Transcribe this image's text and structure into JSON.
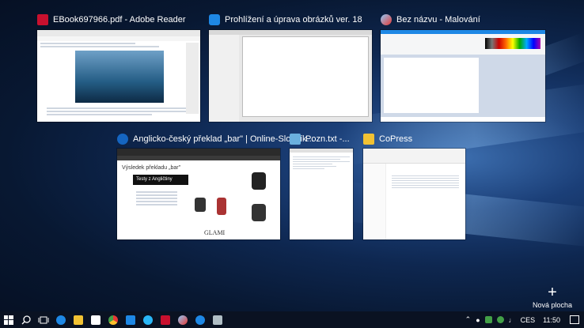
{
  "windows": [
    {
      "id": "adobe",
      "title": "EBook697966.pdf - Adobe Reader",
      "color": "#c8102e"
    },
    {
      "id": "viewer",
      "title": "Prohlížení a úprava obrázků ver. 18",
      "color": "#1e88e5"
    },
    {
      "id": "paint",
      "title": "Bez názvu - Malování",
      "color": "#4aa3df"
    },
    {
      "id": "edge",
      "title": "Anglicko-český překlad „bar\" | Online-Slovník...",
      "color": "#1565c0",
      "page": {
        "heading": "Výsledek překladu „bar\"",
        "ad": "Testy z Angličtiny",
        "brand": "GLAMI"
      }
    },
    {
      "id": "notepad",
      "title": "Pozn.txt -...",
      "color": "#6ab0de"
    },
    {
      "id": "copress",
      "title": "CoPress",
      "color": "#f2c233"
    }
  ],
  "new_desktop": {
    "label": "Nová plocha",
    "icon": "plus-icon"
  },
  "taskbar": {
    "apps": [
      {
        "name": "start",
        "color": "#ffffff"
      },
      {
        "name": "search",
        "color": "#ffffff"
      },
      {
        "name": "task-view",
        "color": "#ffffff"
      },
      {
        "name": "edge",
        "color": "#1e88e5"
      },
      {
        "name": "explorer",
        "color": "#f2c233"
      },
      {
        "name": "store",
        "color": "#ffffff"
      },
      {
        "name": "chrome",
        "color": "#e53935"
      },
      {
        "name": "photos",
        "color": "#1e88e5"
      },
      {
        "name": "ie",
        "color": "#29b6f6"
      },
      {
        "name": "acrobat",
        "color": "#c8102e"
      },
      {
        "name": "paint",
        "color": "#90caf9"
      },
      {
        "name": "viewer",
        "color": "#1e88e5"
      },
      {
        "name": "notepad",
        "color": "#b0bec5"
      }
    ],
    "language": "CES",
    "time": "11:50"
  }
}
